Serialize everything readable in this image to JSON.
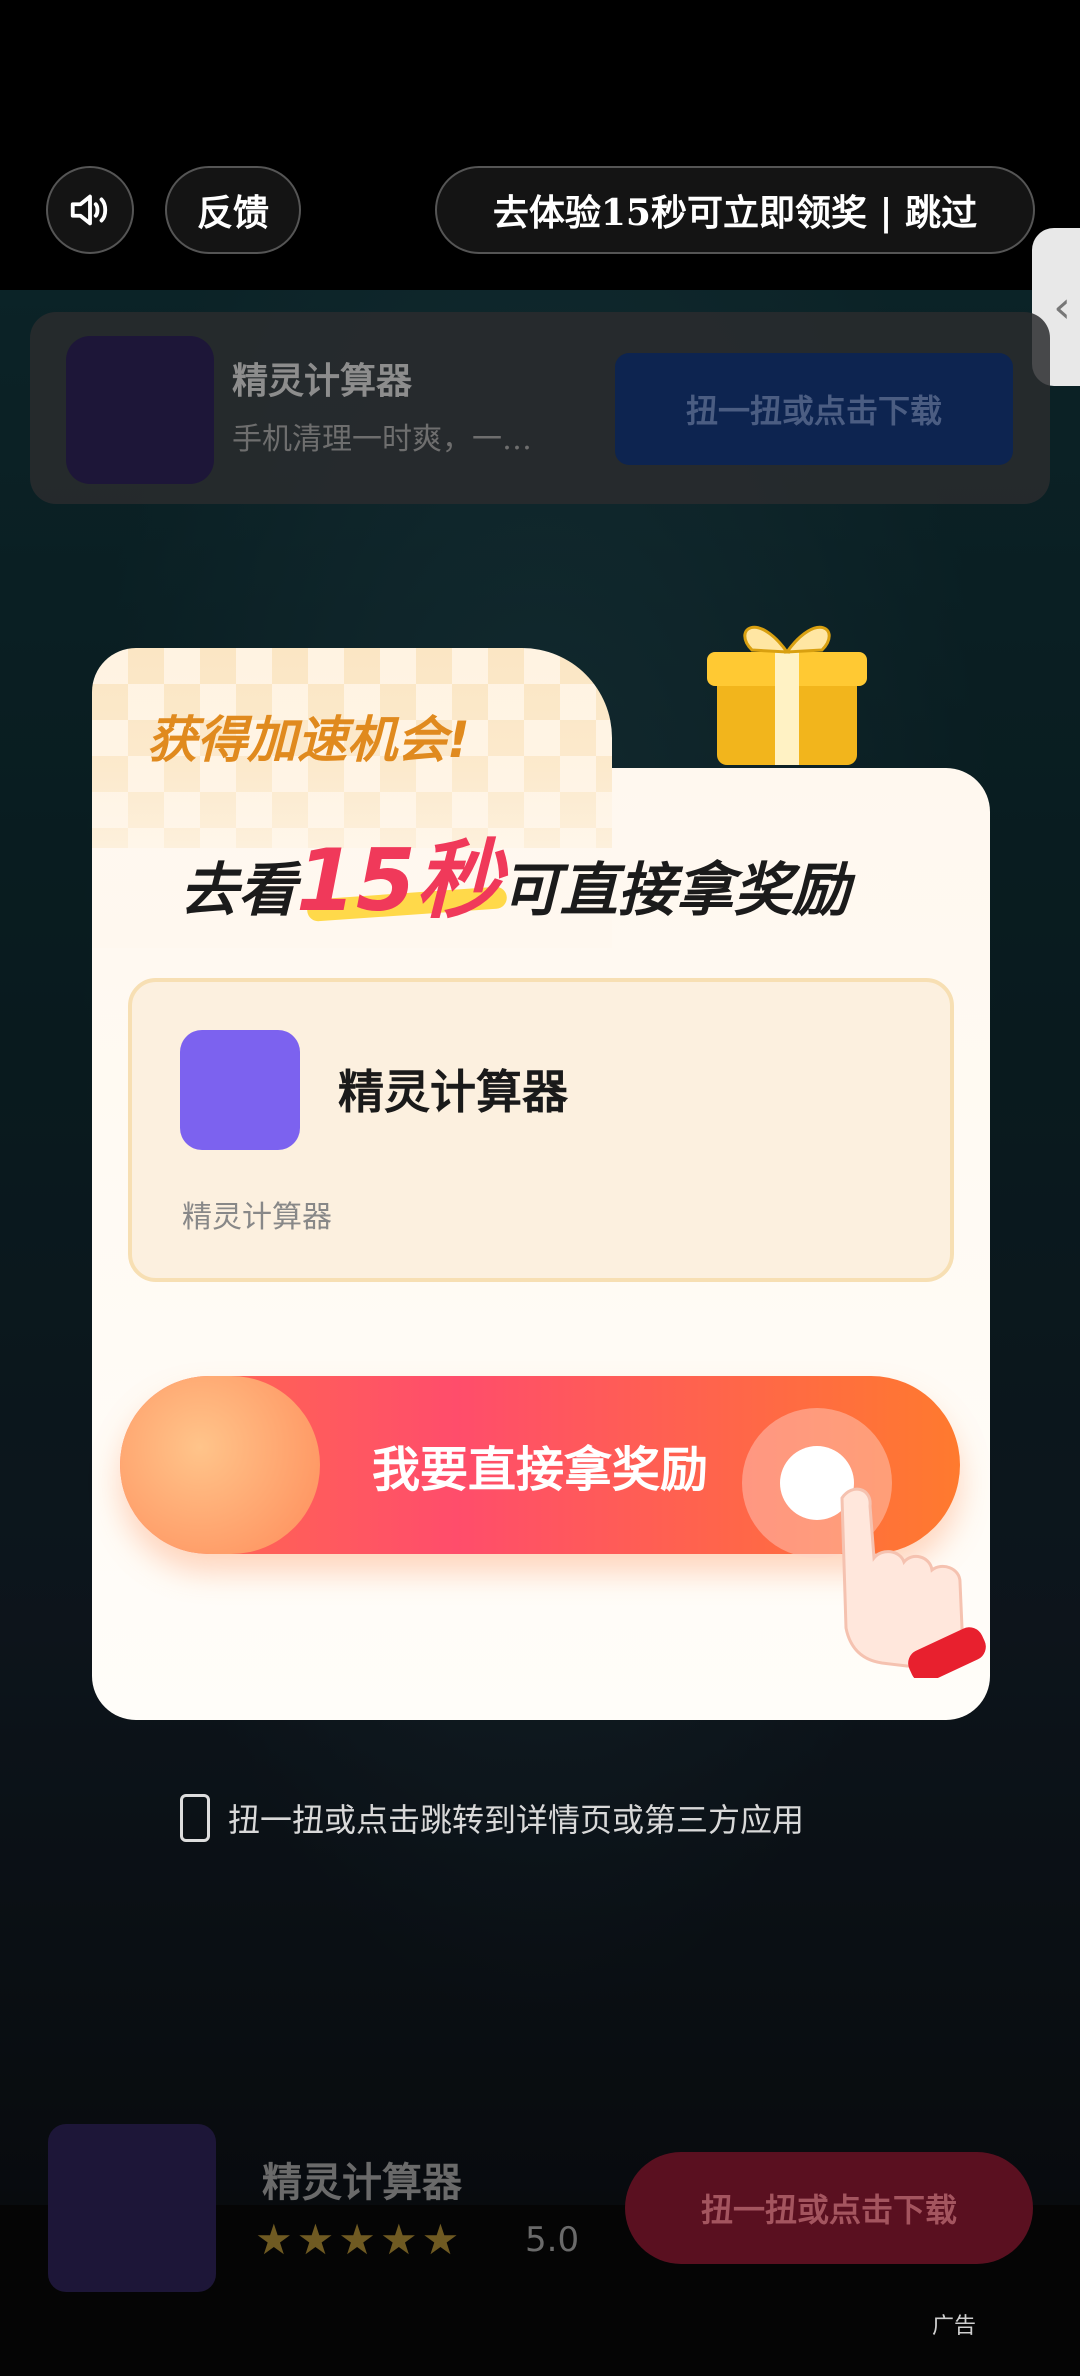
{
  "topbar": {
    "volume_icon": "speaker-icon",
    "feedback_label": "反馈",
    "skip_label": "去体验15秒可立即领奖 | 跳过",
    "side_tab_icon": "chevron-left-icon"
  },
  "top_ad": {
    "app_name": "精灵计算器",
    "description": "手机清理一时爽，一…",
    "button_label": "扭一扭或点击下载"
  },
  "modal": {
    "headline_small": "获得加速机会!",
    "headline_prefix": "去看",
    "headline_highlight": "15秒",
    "headline_suffix": "可直接拿奖励",
    "app_name": "精灵计算器",
    "app_subtitle": "精灵计算器",
    "cta_label": "我要直接拿奖励",
    "icon_color": "#7c62ef"
  },
  "hint": {
    "text": "扭一扭或点击跳转到详情页或第三方应用"
  },
  "bottom_ad": {
    "app_name": "精灵计算器",
    "stars": "★★★★★",
    "rating": "5.0",
    "button_label": "扭一扭或点击下载",
    "ad_tag": "广告"
  }
}
